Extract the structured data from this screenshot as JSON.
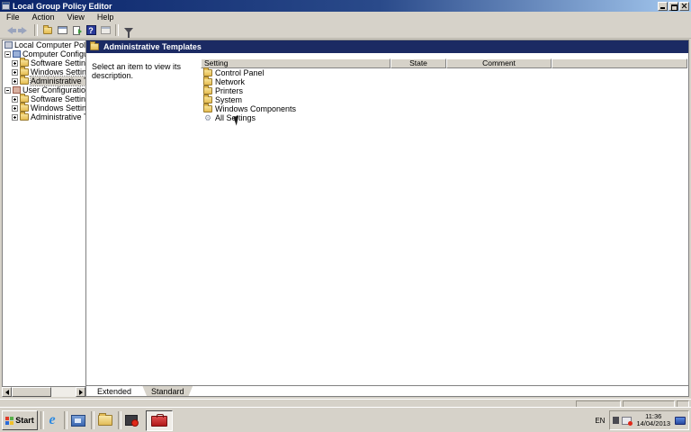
{
  "window": {
    "title": "Local Group Policy Editor"
  },
  "menu": {
    "items": [
      "File",
      "Action",
      "View",
      "Help"
    ]
  },
  "toolbar": {
    "help_glyph": "?",
    "icons": [
      "back-arrow",
      "forward-arrow",
      "up-one-level",
      "show-console-tree",
      "export-list",
      "help",
      "properties",
      "filter"
    ]
  },
  "tree": {
    "root": {
      "label": "Local Computer Policy"
    },
    "items": [
      {
        "label": "Computer Configuratio"
      },
      {
        "label": "Software Settings"
      },
      {
        "label": "Windows Settings"
      },
      {
        "label": "Administrative Tem"
      },
      {
        "label": "User Configuration"
      },
      {
        "label": "Software Settings"
      },
      {
        "label": "Windows Settings"
      },
      {
        "label": "Administrative Tem"
      }
    ]
  },
  "main": {
    "header": {
      "title": "Administrative Templates"
    },
    "description": "Select an item to view its description.",
    "list": {
      "columns": [
        "Setting",
        "State",
        "Comment"
      ],
      "rows": [
        {
          "setting": "Control Panel",
          "icon": "folder"
        },
        {
          "setting": "Network",
          "icon": "folder"
        },
        {
          "setting": "Printers",
          "icon": "folder"
        },
        {
          "setting": "System",
          "icon": "folder"
        },
        {
          "setting": "Windows Components",
          "icon": "folder"
        },
        {
          "setting": "All Settings",
          "icon": "all-settings-gear"
        }
      ]
    },
    "tabs": [
      {
        "label": "Extended",
        "active": true
      },
      {
        "label": "Standard",
        "active": false
      }
    ]
  },
  "icons": {
    "all_settings_glyph": "⚙"
  },
  "taskbar": {
    "start_label": "Start",
    "quick_launch": [
      "internet-explorer",
      "server-manager",
      "windows-explorer",
      "media-app",
      "toolbox-active"
    ],
    "tray": {
      "language": "EN",
      "time": "11:36",
      "date": "14/04/2013"
    }
  },
  "colors": {
    "title_gradient_start": "#0a246a",
    "title_gradient_end": "#a6caf0",
    "header_band": "#1b2a63",
    "chrome_gray": "#d6d2c9",
    "folder_yellow": "#e6bd51"
  }
}
